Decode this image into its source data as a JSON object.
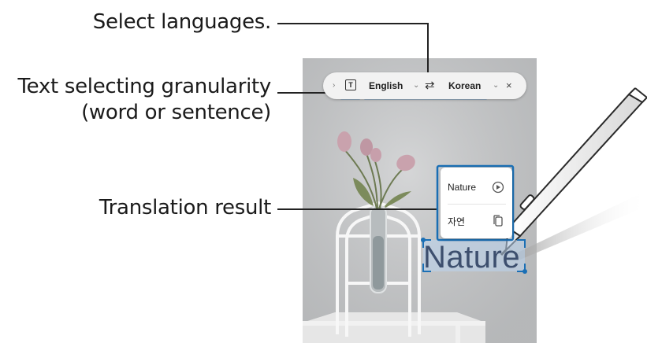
{
  "callouts": {
    "select_languages": "Select languages.",
    "granularity_line1": "Text selecting granularity",
    "granularity_line2": "(word or sentence)",
    "translation_result": "Translation result"
  },
  "toolbar": {
    "mode_icon_glyph": "T",
    "source_language": "English",
    "target_language": "Korean",
    "swap_glyph": "⇄",
    "chevron_glyph": "⌄",
    "close_glyph": "×",
    "icons": [
      "text-mode-icon",
      "swap-languages-icon",
      "chevron-down-icon",
      "close-icon"
    ]
  },
  "result": {
    "source_word": "Nature",
    "translated_word": "자연",
    "icons": [
      "play-icon",
      "copy-icon"
    ]
  },
  "handwriting": {
    "word": "Nature"
  },
  "colors": {
    "highlight_border": "#1a6fb5",
    "selection_fill": "#b9d3ee",
    "photo_background": "#c9cacb",
    "callout_line": "#222222"
  }
}
